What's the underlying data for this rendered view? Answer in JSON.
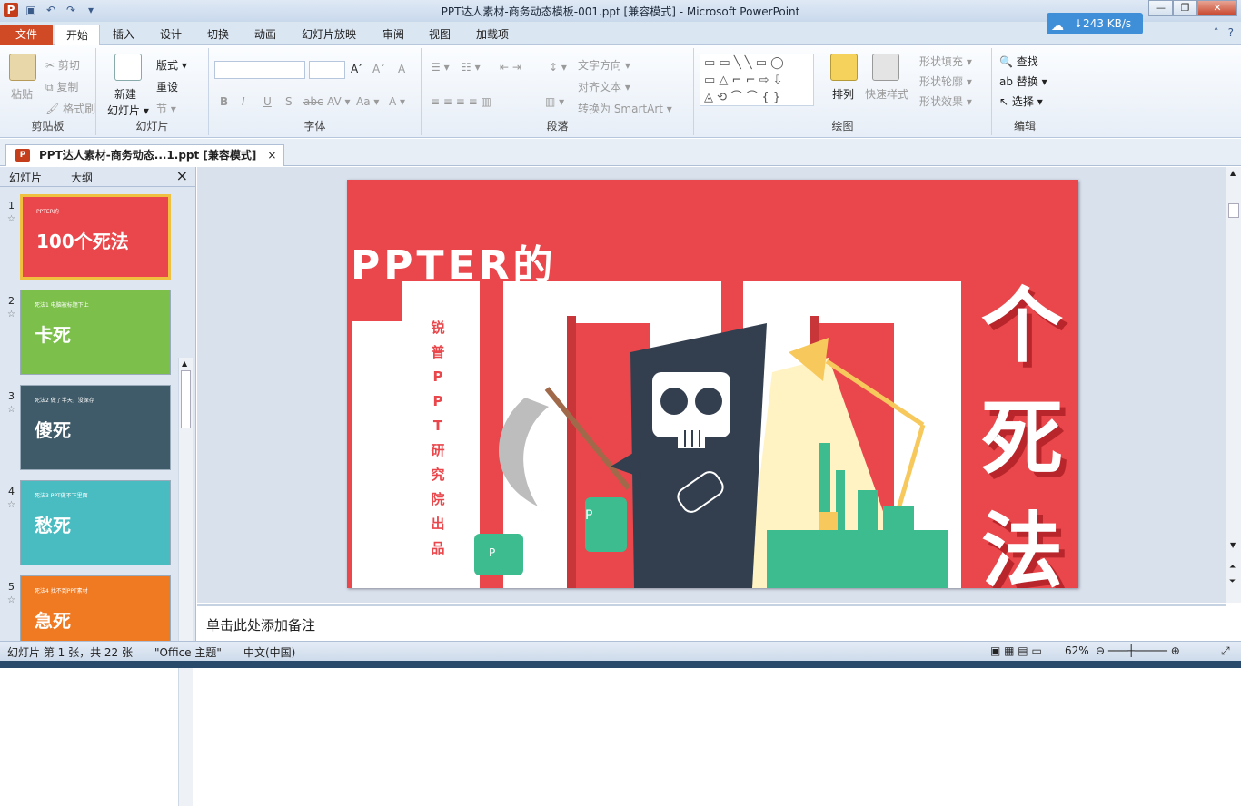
{
  "window": {
    "title": "PPT达人素材-商务动态模板-001.ppt [兼容模式]  -  Microsoft PowerPoint",
    "netspeed": "↓243 KB/s"
  },
  "tabs": [
    "文件",
    "开始",
    "插入",
    "设计",
    "切换",
    "动画",
    "幻灯片放映",
    "审阅",
    "视图",
    "加载项"
  ],
  "ribbon": {
    "clipboard": {
      "paste": "粘贴",
      "cut": "剪切",
      "copy": "复制",
      "format_painter": "格式刷",
      "label": "剪贴板"
    },
    "slides": {
      "new_slide": "新建",
      "new_slide2": "幻灯片 ▾",
      "layout": "版式 ▾",
      "reset": "重设",
      "section": "节 ▾",
      "label": "幻灯片"
    },
    "font": {
      "label": "字体",
      "bold": "B",
      "italic": "I",
      "underline": "U",
      "shadow": "S",
      "strike": "abc",
      "spacing": "AV ▾",
      "case": "Aa ▾",
      "color": "A ▾",
      "grow": "A˄",
      "shrink": "A˅",
      "clear": "A"
    },
    "paragraph": {
      "label": "段落",
      "text_direction": "文字方向 ▾",
      "align_text": "对齐文本 ▾",
      "smartart": "转换为 SmartArt ▾"
    },
    "drawing": {
      "label": "绘图",
      "arrange": "排列",
      "quick_styles": "快速样式",
      "fill": "形状填充 ▾",
      "outline": "形状轮廓 ▾",
      "effects": "形状效果 ▾"
    },
    "editing": {
      "label": "编辑",
      "find": "查找",
      "replace": "替换 ▾",
      "select": "选择 ▾"
    }
  },
  "doc_tab": {
    "name": "PPT达人素材-商务动态...1.ppt [兼容模式]",
    "close": "×"
  },
  "panel": {
    "tab_slides": "幻灯片",
    "tab_outline": "大纲",
    "close": "×"
  },
  "thumbnails": [
    {
      "num": "1",
      "sub": "PPTER的",
      "title": "100个死法",
      "color": "#e9474b"
    },
    {
      "num": "2",
      "sub": "死法1 电脑被标题下上",
      "title": "卡死",
      "color": "#7cc04b"
    },
    {
      "num": "3",
      "sub": "死法2 做了半天，没保存",
      "title": "傻死",
      "color": "#3f5a68"
    },
    {
      "num": "4",
      "sub": "死法3 PPT做不下里面",
      "title": "愁死",
      "color": "#49bcc1"
    },
    {
      "num": "5",
      "sub": "死法4 找不到PPT素材",
      "title": "急死",
      "color": "#f07a22"
    }
  ],
  "slide": {
    "heading": "PPTER的",
    "number": "100",
    "side_text": [
      "锐",
      "普",
      "P",
      "P",
      "T",
      "研",
      "究",
      "院",
      "出",
      "品"
    ],
    "right_text": [
      "个",
      "死",
      "法"
    ],
    "chair_letter": "P",
    "chair_letter2": "P"
  },
  "notes": {
    "placeholder": "单击此处添加备注"
  },
  "status": {
    "slide_info": "幻灯片 第 1 张，共 22 张",
    "theme": "\"Office 主题\"",
    "lang": "中文(中国)",
    "zoom": "62%"
  },
  "colors": {
    "slide_red": "#e9474b",
    "dark": "#333f4f",
    "green": "#3dbd8f",
    "lamp": "#f7c95c"
  }
}
